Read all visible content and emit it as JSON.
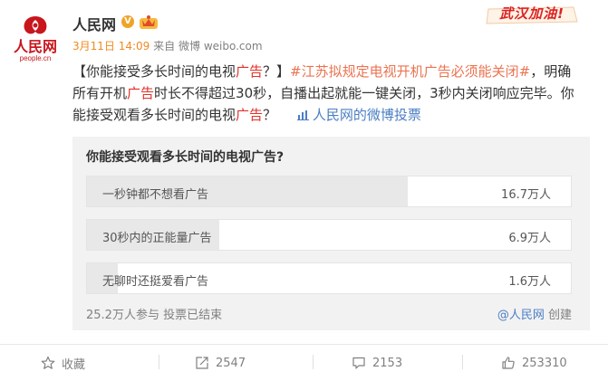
{
  "header": {
    "logo_wordmark": "人民网",
    "logo_domain": "people.cn",
    "username": "人民网",
    "date": "3月11日",
    "time": "14:09",
    "source_prefix": "来自",
    "source": "微博 weibo.com",
    "campaign_badge": "武汉加油!",
    "verified_glyph": "V"
  },
  "post": {
    "bracket_open": "【你能接受多长时间的电视",
    "ad1": "广告",
    "bracket_close": "？】",
    "topic": "#江苏拟规定电视开机广告必须能关闭#",
    "text1": "，明确所有开机",
    "ad2": "广告",
    "text2": "时长不得超过30秒，自播出起就能一键关闭，3秒内关闭响应完毕。你能接受观看多长时间的电视",
    "ad3": "广告",
    "text3": "？",
    "vote_link": "人民网的微博投票"
  },
  "poll": {
    "question": "你能接受观看多长时间的电视广告?",
    "options": [
      {
        "label": "一秒钟都不想看广告",
        "count": "16.7万人",
        "share": 0.663
      },
      {
        "label": "30秒内的正能量广告",
        "count": "6.9万人",
        "share": 0.274
      },
      {
        "label": "无聊时还挺爱看广告",
        "count": "1.6万人",
        "share": 0.063
      }
    ],
    "footer": "25.2万人参与  投票已结束",
    "creator_at": "@人民网",
    "creator_suffix": "创建"
  },
  "actions": {
    "favorite": "收藏",
    "repost": "2547",
    "comment": "2153",
    "like": "253310"
  },
  "colors": {
    "brand_red": "#c8161d",
    "link": "#eb7350",
    "blue_link": "#4b7ec4"
  }
}
